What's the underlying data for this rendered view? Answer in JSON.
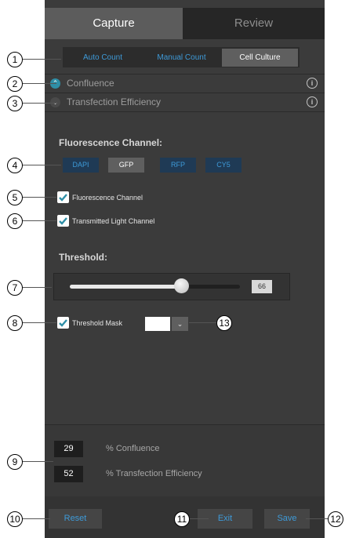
{
  "tabs": [
    {
      "label": "Capture",
      "active": true
    },
    {
      "label": "Review",
      "active": false
    }
  ],
  "modes": [
    {
      "label": "Auto Count",
      "active": false
    },
    {
      "label": "Manual Count",
      "active": false
    },
    {
      "label": "Cell Culture",
      "active": true
    }
  ],
  "sections": {
    "confluence": {
      "label": "Confluence",
      "expanded": false
    },
    "transfection": {
      "label": "Transfection Efficiency",
      "expanded": true
    }
  },
  "fluorescence": {
    "title": "Fluorescence Channel:",
    "channels": [
      {
        "label": "DAPI",
        "selected": false
      },
      {
        "label": "GFP",
        "selected": true
      },
      {
        "label": "RFP",
        "selected": false
      },
      {
        "label": "CY5",
        "selected": false
      }
    ]
  },
  "checkboxes": {
    "fluorescence_channel": {
      "label": "Fluorescence Channel",
      "checked": true
    },
    "transmitted_light": {
      "label": "Transmitted Light Channel",
      "checked": true
    },
    "threshold_mask": {
      "label": "Threshold Mask",
      "checked": true
    }
  },
  "threshold": {
    "title": "Threshold:",
    "value": "66",
    "fraction": 0.66
  },
  "mask_color": "#ffffff",
  "results": [
    {
      "value": "29",
      "label": "% Confluence"
    },
    {
      "value": "52",
      "label": "% Transfection Efficiency"
    }
  ],
  "footer": {
    "reset": "Reset",
    "exit": "Exit",
    "save": "Save"
  },
  "callouts": [
    "1",
    "2",
    "3",
    "4",
    "5",
    "6",
    "7",
    "8",
    "9",
    "10",
    "11",
    "12",
    "13"
  ],
  "colors": {
    "accent": "#3e9ad8",
    "panel": "#3b3b3b",
    "teal": "#2f8fa7"
  }
}
